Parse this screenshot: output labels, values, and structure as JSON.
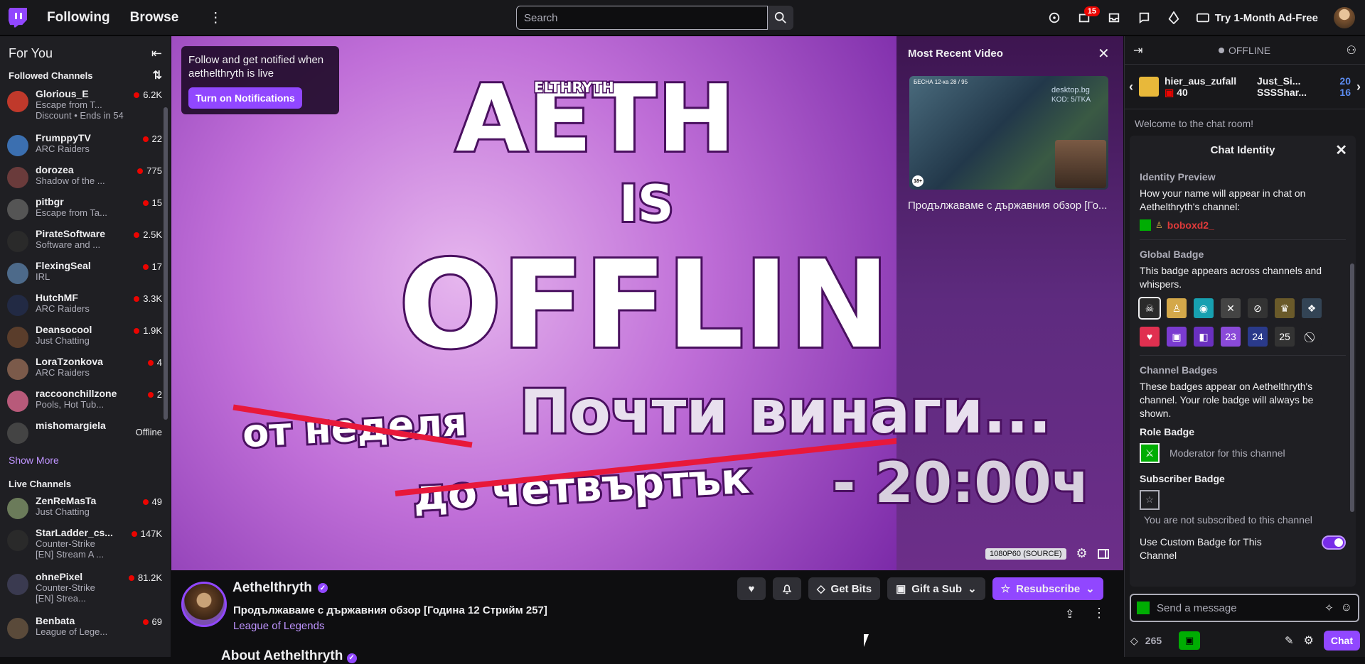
{
  "nav": {
    "following": "Following",
    "browse": "Browse",
    "search_placeholder": "Search",
    "notif_count": "15",
    "ad_free": "Try 1-Month Ad-Free"
  },
  "sidebar": {
    "for_you": "For You",
    "followed_channels": "Followed Channels",
    "show_more": "Show More",
    "live_channels": "Live Channels",
    "followed": [
      {
        "name": "Glorious_E",
        "game": "Escape from T...",
        "viewers": "6.2K",
        "extra": "Discount • Ends in 54",
        "color": "#c0392b"
      },
      {
        "name": "FrumppyTV",
        "game": "ARC Raiders",
        "viewers": "22",
        "color": "#3b6fb0"
      },
      {
        "name": "dorozea",
        "game": "Shadow of the ...",
        "viewers": "775",
        "color": "#6a3b3b"
      },
      {
        "name": "pitbgr",
        "game": "Escape from Ta...",
        "viewers": "15",
        "color": "#555555"
      },
      {
        "name": "PirateSoftware",
        "game": "Software and ...",
        "viewers": "2.5K",
        "color": "#2a2a2a"
      },
      {
        "name": "FlexingSeal",
        "game": "IRL",
        "viewers": "17",
        "color": "#4d6a8a"
      },
      {
        "name": "HutchMF",
        "game": "ARC Raiders",
        "viewers": "3.3K",
        "color": "#222a44"
      },
      {
        "name": "Deansocool",
        "game": "Just Chatting",
        "viewers": "1.9K",
        "color": "#5a3d2b"
      },
      {
        "name": "LoraTzonkova",
        "game": "ARC Raiders",
        "viewers": "4",
        "color": "#7b5a4a"
      },
      {
        "name": "raccoonchillzone",
        "game": "Pools, Hot Tub...",
        "viewers": "2",
        "color": "#b85a7a"
      },
      {
        "name": "mishomargiela",
        "game": "",
        "viewers": "Offline",
        "color": "#444444"
      }
    ],
    "live": [
      {
        "name": "ZenReMasTa",
        "game": "Just Chatting",
        "viewers": "49",
        "color": "#6b7b5a"
      },
      {
        "name": "StarLadder_cs...",
        "game": "Counter-Strike",
        "viewers": "147K",
        "extra": "[EN] Stream A ...",
        "color": "#2a2a2a"
      },
      {
        "name": "ohnePixel",
        "game": "Counter-Strike",
        "viewers": "81.2K",
        "extra": "[EN] Strea...",
        "color": "#3a3a50"
      },
      {
        "name": "Benbata",
        "game": "League of Lege...",
        "viewers": "69",
        "color": "#5a4a3a"
      }
    ]
  },
  "player": {
    "follow_text": "Follow and get notified when aethelthryth is live",
    "notif_button": "Turn on Notifications",
    "art_name": "AETH",
    "art_small": "ELTHRYTH",
    "art_is": "IS",
    "art_offline": "OFFLINE",
    "art_from": "от неделя",
    "art_to": "до четвъртък",
    "art_almost": "Почти винаги...",
    "art_time": "- 20:00ч",
    "most_recent_video": "Most Recent Video",
    "video_caption": "Продължаваме с държавния обзор [Го...",
    "thumb_top": "БЕСНА 12-ка 28 / 95",
    "thumb_site": "desktop.bg",
    "thumb_code": "KOD: 5/TKA",
    "thumb_rating": "18+",
    "quality": "1080P60 (SOURCE)"
  },
  "channel": {
    "name": "Aethelthryth",
    "title": "Продължаваме с държавния обзор [Година 12 Стрийм 257]",
    "game": "League of Legends",
    "about": "About Aethelthryth",
    "get_bits": "Get Bits",
    "gift_sub": "Gift a Sub",
    "resubscribe": "Resubscribe"
  },
  "chat": {
    "status": "OFFLINE",
    "gift_user": "hier_aus_zufall",
    "gift_count": "40",
    "leader1": "Just_Si...",
    "leader1_count": "20",
    "leader2": "SSSShar...",
    "leader2_count": "16",
    "welcome": "Welcome to the chat room!",
    "identity_title": "Chat Identity",
    "identity_preview": "Identity Preview",
    "identity_desc": "How your name will appear in chat on Aethelthryth's channel:",
    "username": "boboxd2_",
    "global_badge": "Global Badge",
    "global_desc": "This badge appears across channels and whispers.",
    "channel_badges": "Channel Badges",
    "channel_desc": "These badges appear on Aethelthryth's channel. Your role badge will always be shown.",
    "role_badge": "Role Badge",
    "role_desc": "Moderator for this channel",
    "subscriber_badge": "Subscriber Badge",
    "sub_desc": "You are not subscribed to this channel",
    "custom_badge": "Use Custom Badge for This Channel",
    "input_placeholder": "Send a message",
    "points": "265",
    "chat_button": "Chat",
    "badge_glyphs": [
      "☠",
      "♙",
      "◉",
      "✕",
      "⊘",
      "♛",
      "❖",
      "♥",
      "▣",
      "◧",
      "23",
      "24",
      "25",
      "⃠"
    ],
    "badge_colors": [
      "#2a2a2a",
      "#d4a84a",
      "#17a0b0",
      "#444",
      "#333",
      "#6a5a2a",
      "#334455",
      "#e03050",
      "#7a3bd0",
      "#6a30c0",
      "#8a4ad8",
      "#2a3a8a",
      "#333",
      "#1f1f23"
    ]
  }
}
